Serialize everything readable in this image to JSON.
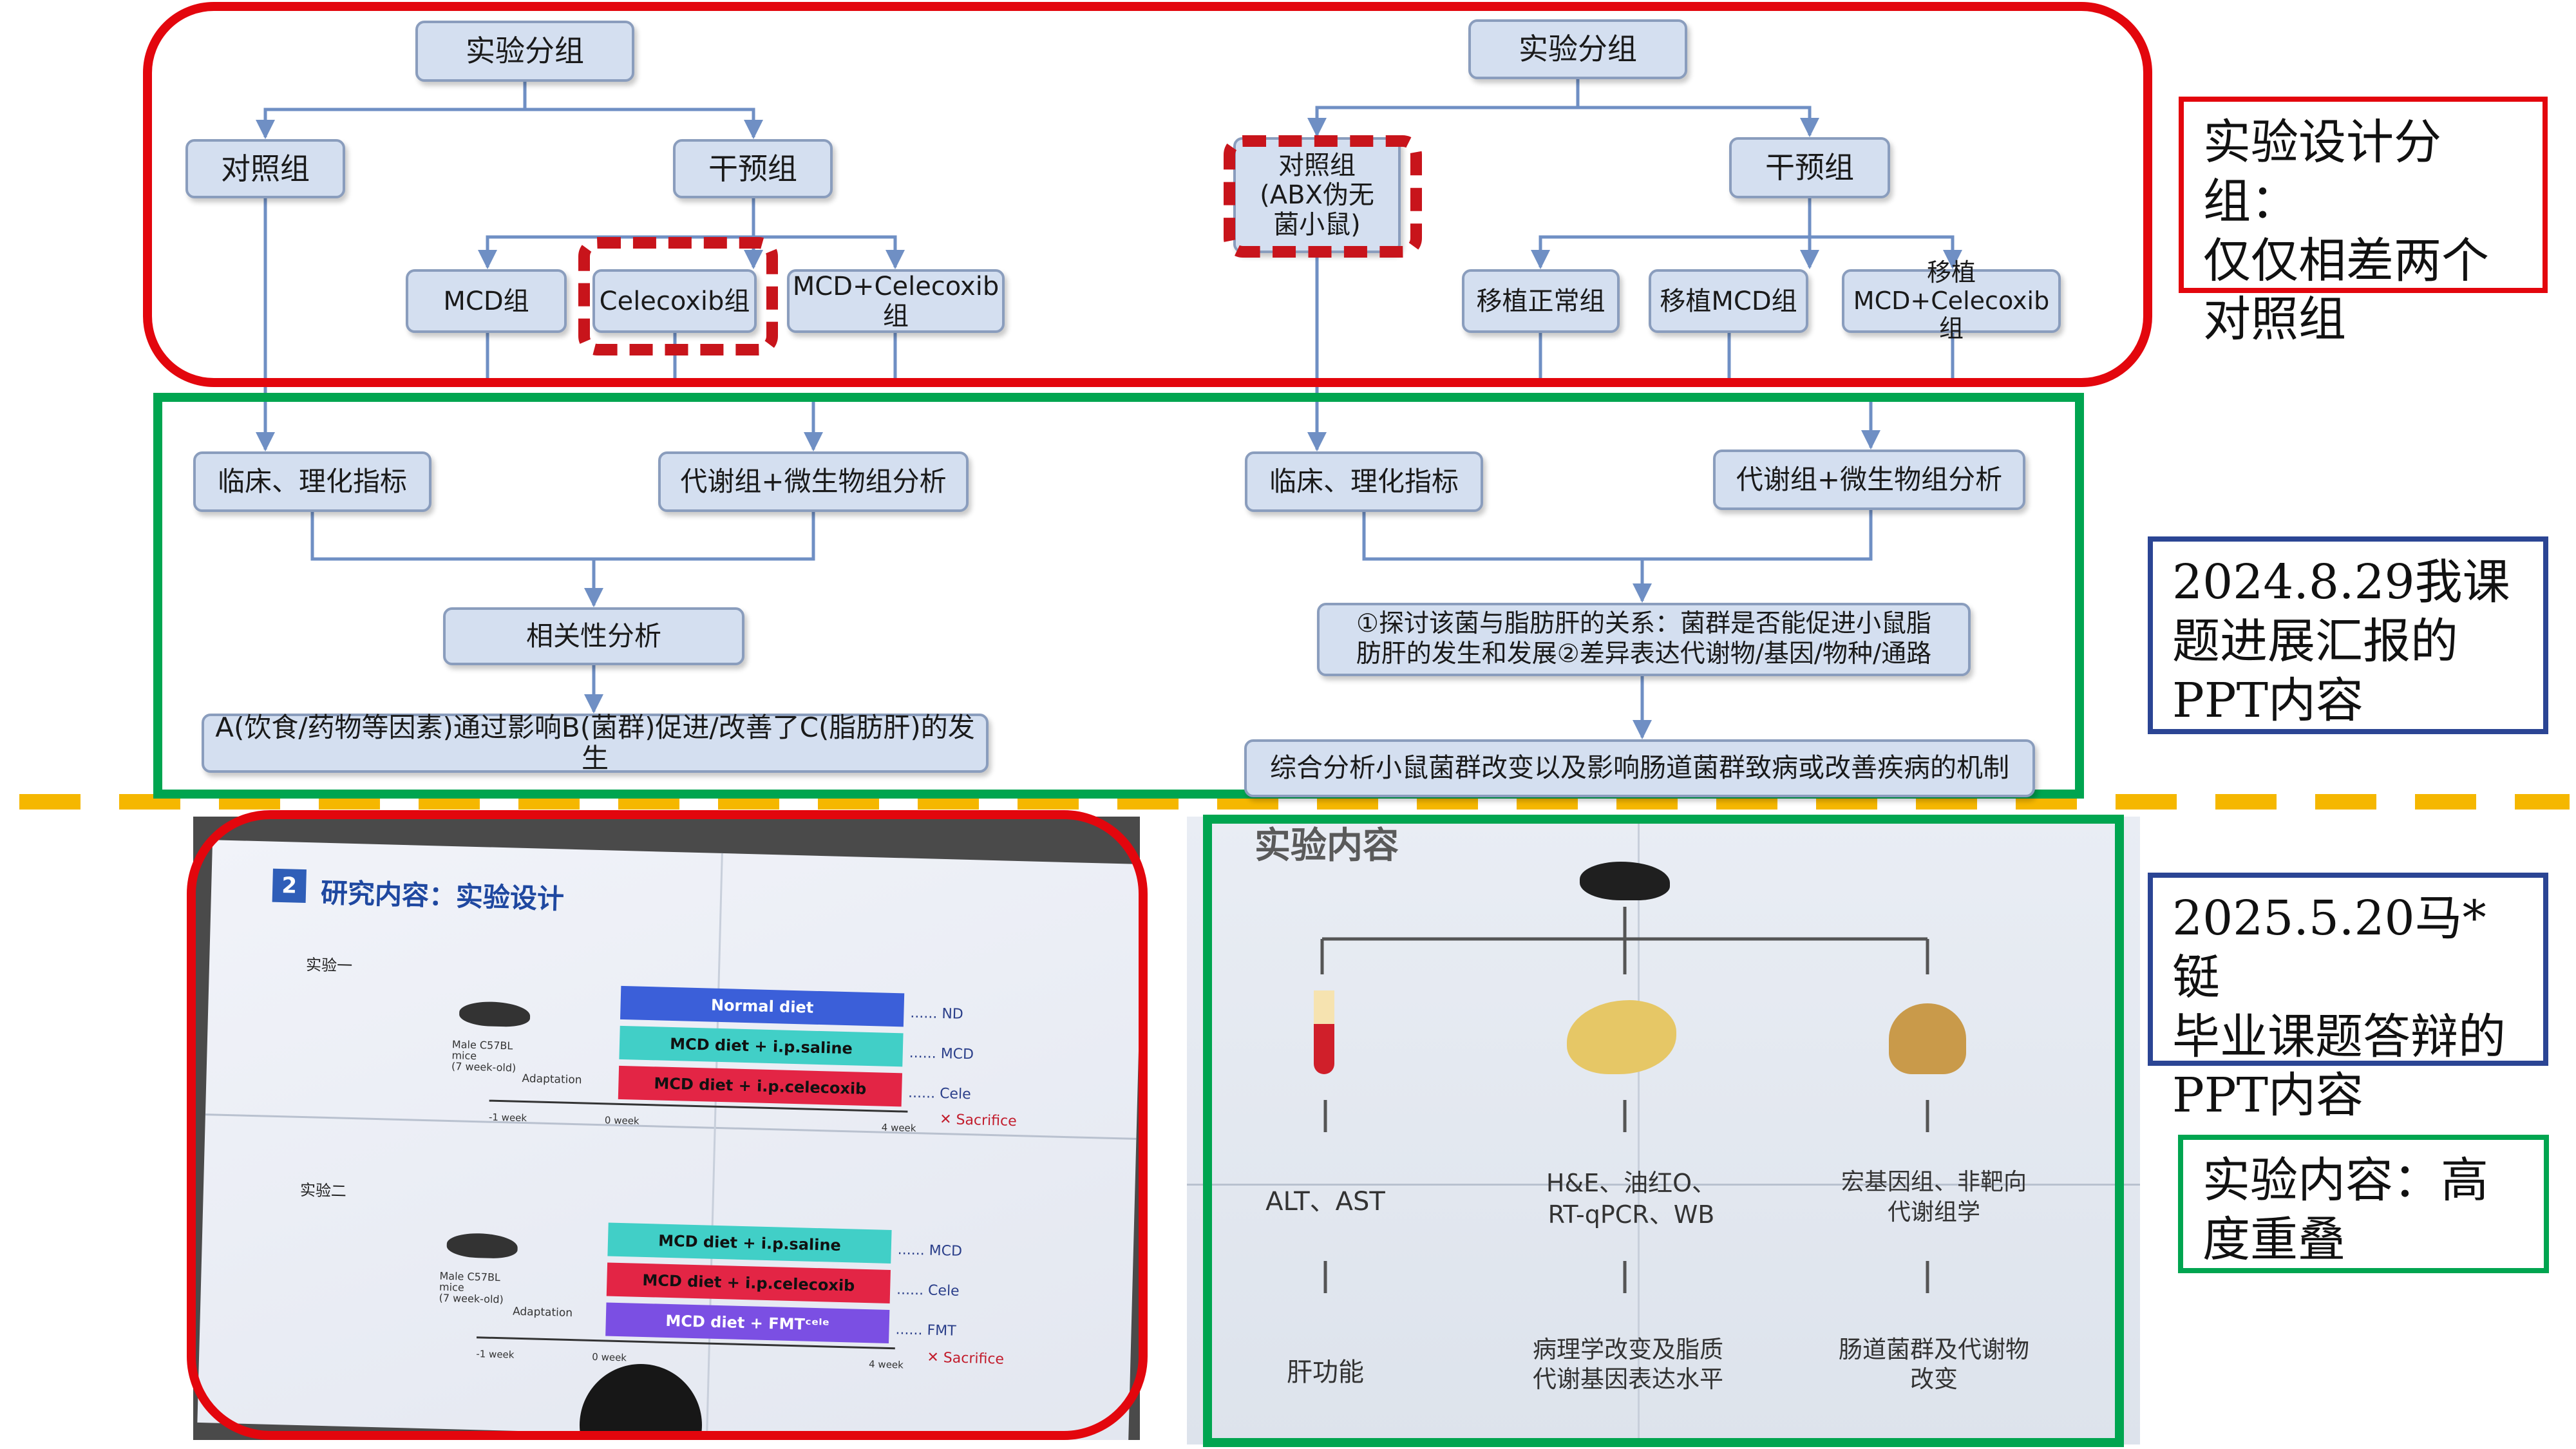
{
  "colors": {
    "red": "#e3060d",
    "green": "#00a550",
    "blue": "#2b4594",
    "orange": "#f5b700",
    "box_fill": "#d4dff0",
    "box_border": "#8a9dbd"
  },
  "flow_left": {
    "root": "实验分组",
    "control": "对照组",
    "intervention": "干预组",
    "mcd": "MCD组",
    "celecoxib": "Celecoxib组",
    "mcd_celecoxib": "MCD+Celecoxib组",
    "clinical": "临床、理化指标",
    "metab": "代谢组+微生物组分析",
    "corr": "相关性分析",
    "conclusion": "A(饮食/药物等因素)通过影响B(菌群)促进/改善了C(脂肪肝)的发生"
  },
  "flow_right": {
    "root": "实验分组",
    "control": "对照组\n(ABX伪无\n菌小鼠)",
    "intervention": "干预组",
    "fmt_normal": "移植正常组",
    "fmt_mcd": "移植MCD组",
    "fmt_mcd_cele": "移植\nMCD+Celecoxib组",
    "clinical": "临床、理化指标",
    "metab": "代谢组+微生物组分析",
    "explore": "①探讨该菌与脂肪肝的关系：菌群是否能促进小鼠脂\n肪肝的发生和发展②差异表达代谢物/基因/物种/通路",
    "summary": "综合分析小鼠菌群改变以及影响肠道菌群致病或改善疾病的机制"
  },
  "notes": {
    "grouping": "实验设计分组：\n仅仅相差两个\n对照组",
    "report_2024": "2024.8.29我课\n题进展汇报的\nPPT内容",
    "defense_2025": "2025.5.20马*铤\n毕业课题答辩的\nPPT内容",
    "overlap": "实验内容：高\n度重叠"
  },
  "photo_left": {
    "section_num": "2",
    "title": "研究内容：实验设计",
    "exp1": {
      "label": "实验一",
      "mice": "Male C57BL\nmice\n(7 week-old)",
      "adaptation": "Adaptation",
      "bars": [
        "Normal diet",
        "MCD diet + i.p.saline",
        "MCD diet + i.p.celecoxib"
      ],
      "groups": [
        "...... ND",
        "...... MCD",
        "...... Cele"
      ],
      "sacrifice": "✕ Sacrifice",
      "ticks": [
        "-1 week",
        "0 week",
        "4 week"
      ]
    },
    "exp2": {
      "label": "实验二",
      "mice": "Male C57BL\nmice\n(7 week-old)",
      "adaptation": "Adaptation",
      "bars": [
        "MCD diet + i.p.saline",
        "MCD diet + i.p.celecoxib",
        "MCD diet + FMTᶜᵉˡᵉ"
      ],
      "groups": [
        "...... MCD",
        "...... Cele",
        "...... FMT"
      ],
      "sacrifice": "✕ Sacrifice",
      "ticks": [
        "-1 week",
        "0 week",
        "4 week"
      ]
    }
  },
  "photo_right": {
    "header": "实验内容",
    "cols": [
      {
        "assay": "ALT、AST",
        "result": "肝功能"
      },
      {
        "assay": "H&E、油红O、\nRT-qPCR、WB",
        "result": "病理学改变及脂质\n代谢基因表达水平"
      },
      {
        "assay": "宏基因组、非靶向\n代谢组学",
        "result": "肠道菌群及代谢物\n改变"
      }
    ]
  }
}
